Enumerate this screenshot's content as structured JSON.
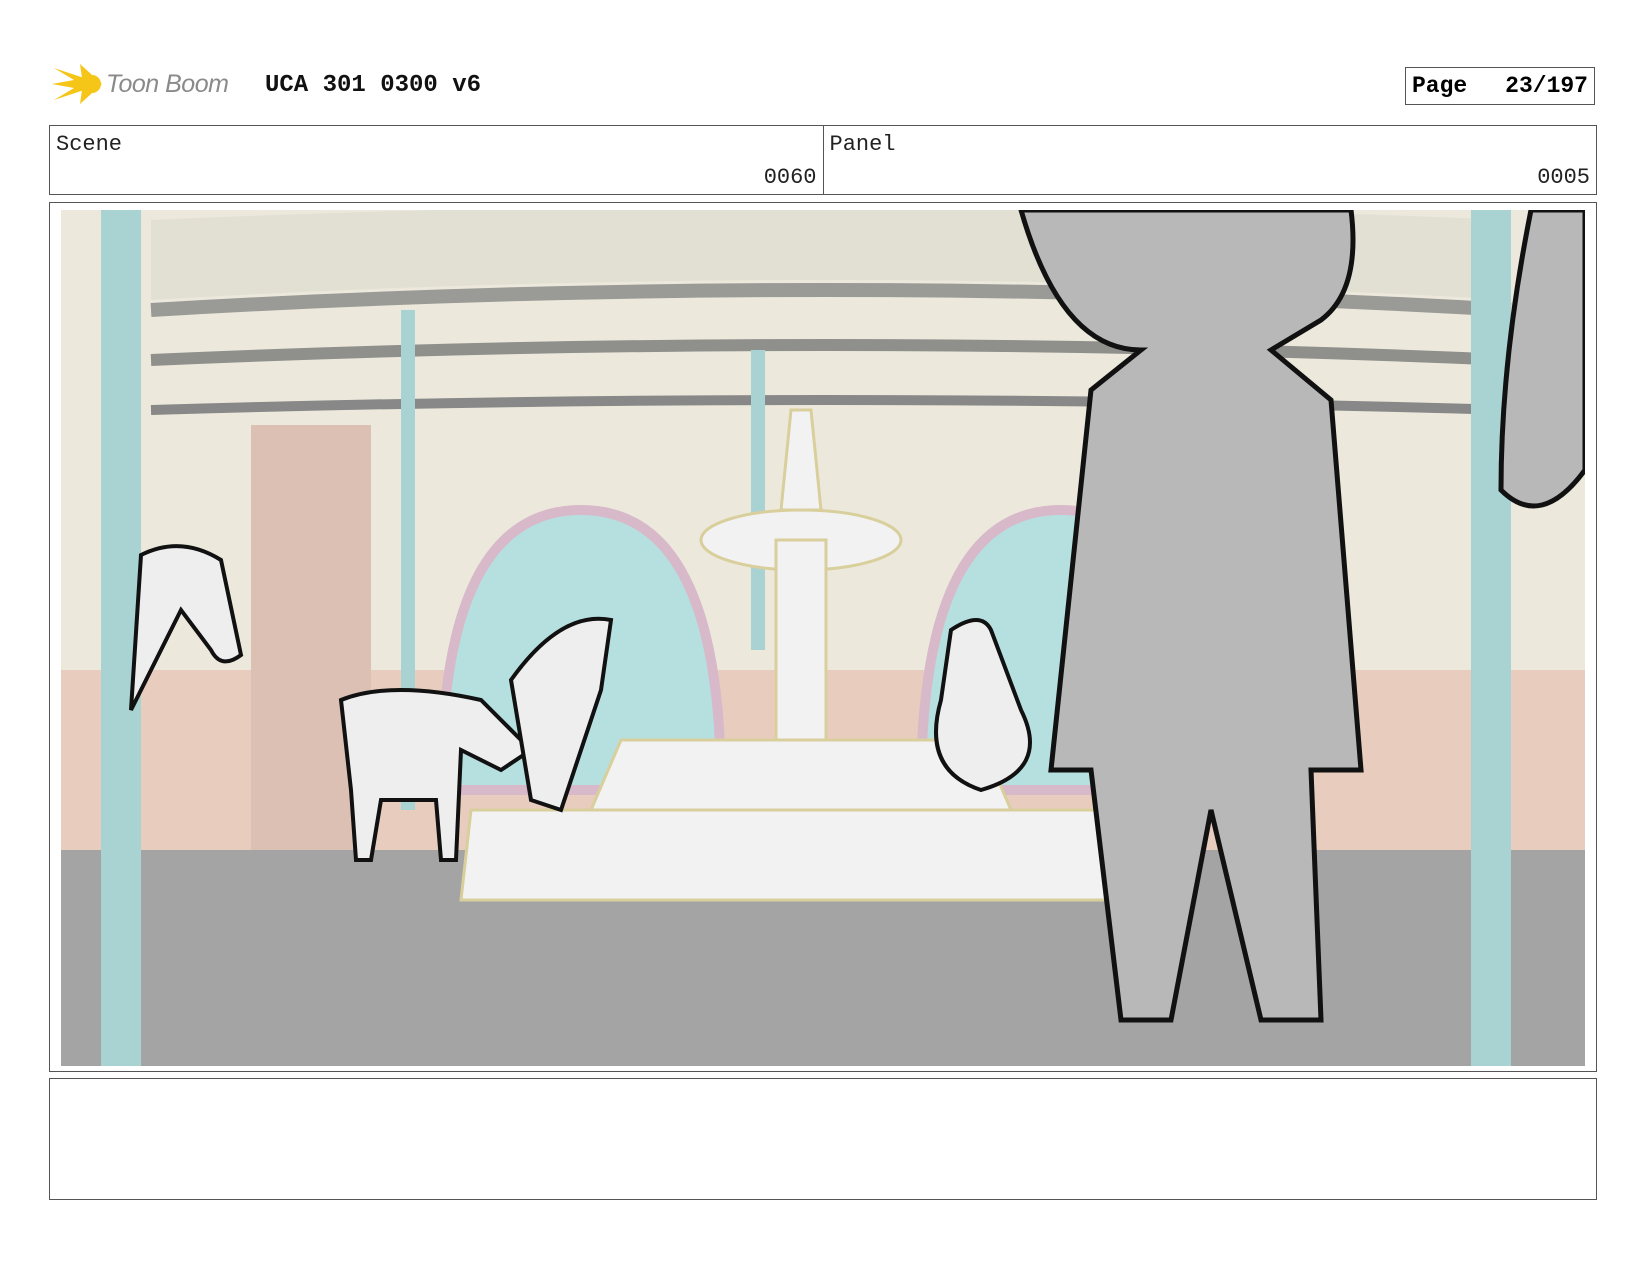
{
  "header": {
    "logo_text": "Toon Boom",
    "project_title": "UCA 301 0300 v6",
    "page_label": "Page",
    "page_value": "23/197"
  },
  "info": {
    "scene_label": "Scene",
    "scene_value": "0060",
    "panel_label": "Panel",
    "panel_value": "0005"
  },
  "dialog": {
    "text": ""
  },
  "colors": {
    "floor": "#a4a4a4",
    "wall": "#ece9dc",
    "pillar": "#a9d2d2",
    "window": "#b6e0e0",
    "figure": "#b8b8b8"
  }
}
